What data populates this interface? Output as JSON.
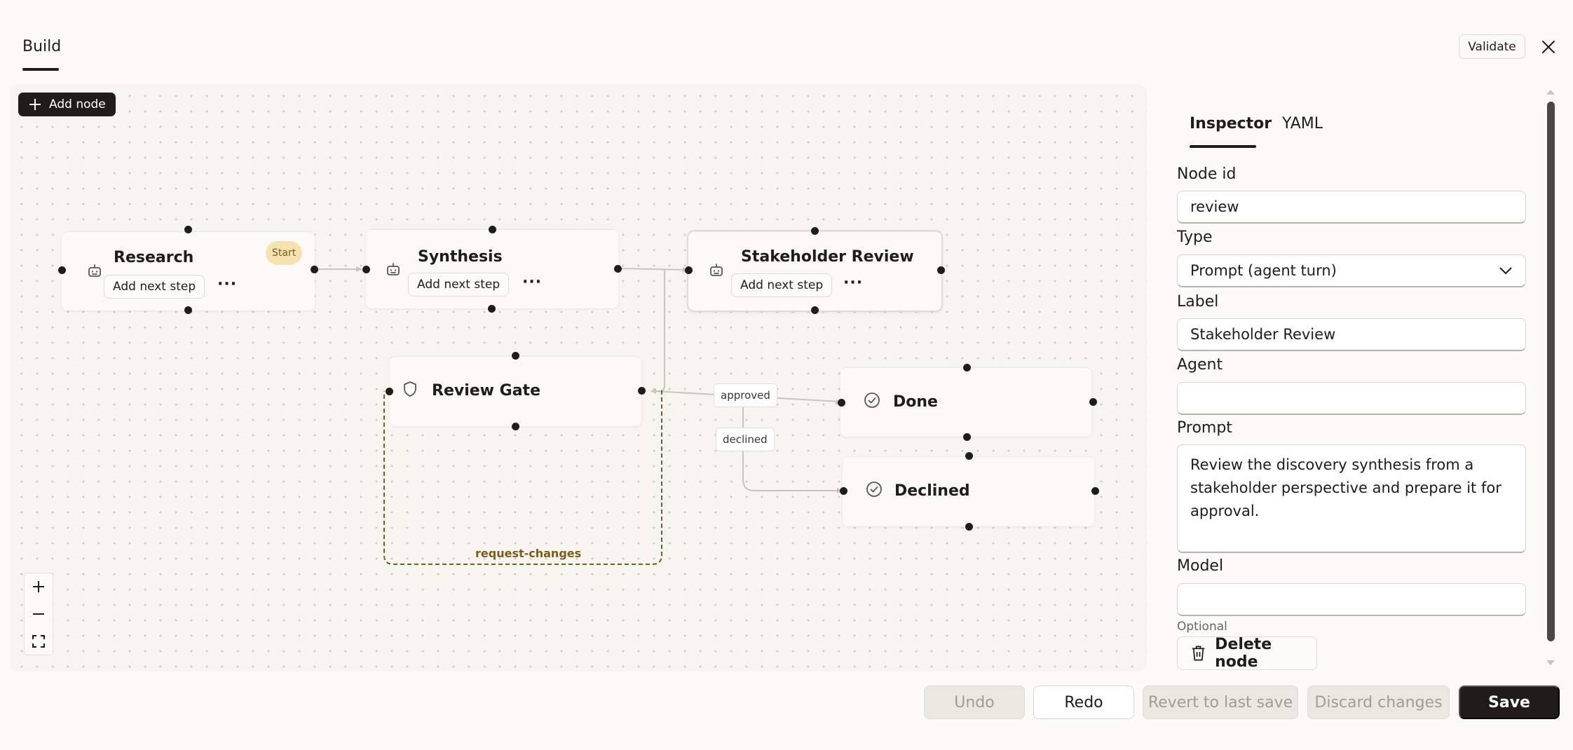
{
  "header": {
    "tab_build": "Build",
    "validate_label": "Validate"
  },
  "canvas": {
    "add_node_label": "Add node",
    "nodes": {
      "research": {
        "title": "Research",
        "add_step": "Add next step",
        "more": "···",
        "badge": "Start"
      },
      "synthesis": {
        "title": "Synthesis",
        "add_step": "Add next step",
        "more": "···"
      },
      "stakeholder": {
        "title": "Stakeholder Review",
        "add_step": "Add next step",
        "more": "···"
      },
      "gate": {
        "title": "Review Gate"
      },
      "done": {
        "title": "Done"
      },
      "declined": {
        "title": "Declined"
      }
    },
    "edge_labels": {
      "approved": "approved",
      "declined": "declined",
      "request_changes": "request-changes"
    }
  },
  "inspector": {
    "tabs": [
      "Inspector",
      "YAML"
    ],
    "node_id_label": "Node id",
    "node_id_value": "review",
    "type_label": "Type",
    "type_value": "Prompt (agent turn)",
    "label_label": "Label",
    "label_value": "Stakeholder Review",
    "agent_label": "Agent",
    "agent_value": "",
    "prompt_label": "Prompt",
    "prompt_value": "Review the discovery synthesis from a stakeholder perspective and prepare it for approval.",
    "model_label": "Model",
    "model_value": "",
    "model_hint": "Optional",
    "delete_label": "Delete node"
  },
  "footer": {
    "undo": "Undo",
    "redo": "Redo",
    "revert": "Revert to last save",
    "discard": "Discard changes",
    "save": "Save"
  },
  "colors": {
    "accent_dark": "#1f1d1a",
    "start_badge": "#f6e2b1",
    "loop_edge": "#7a5c1b"
  },
  "icons": {
    "agent": "robot-icon",
    "gate": "shield-icon",
    "end": "check-circle-icon"
  }
}
